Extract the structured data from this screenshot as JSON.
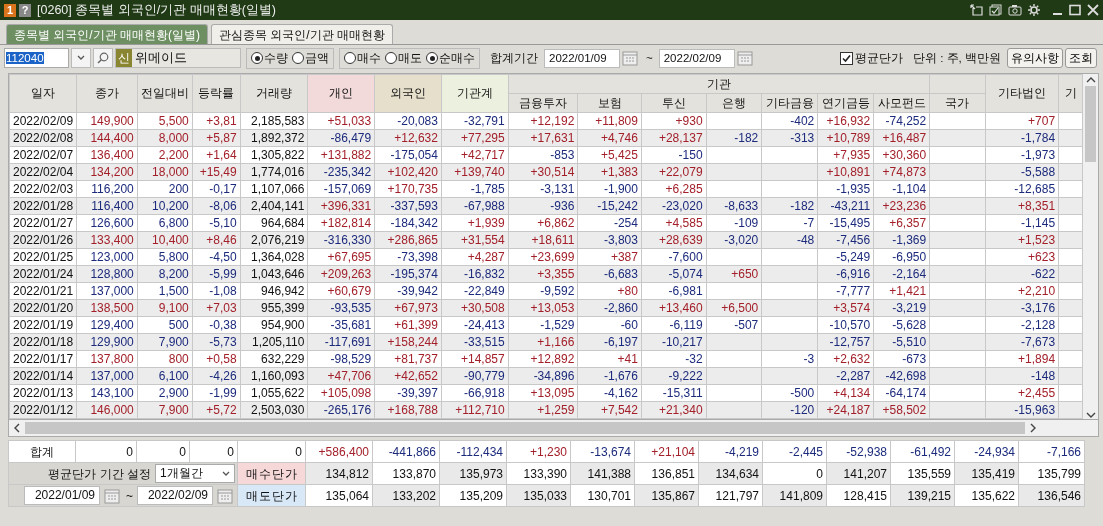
{
  "window": {
    "number_badge": "1",
    "help": "?",
    "title": "[0260] 종목별 외국인/기관 매매현황(일별)"
  },
  "tabs": [
    {
      "label": "종목별 외국인/기관 매매현황(일별)",
      "selected": true
    },
    {
      "label": "관심종목 외국인/기관 매매현황",
      "selected": false
    }
  ],
  "toolbar": {
    "code": "112040",
    "badge": "신",
    "name": "위메이드",
    "measure_options": [
      {
        "label": "수량",
        "selected": true
      },
      {
        "label": "금액",
        "selected": false
      }
    ],
    "side_options": [
      {
        "label": "매수",
        "selected": false
      },
      {
        "label": "매도",
        "selected": false
      },
      {
        "label": "순매수",
        "selected": true
      }
    ],
    "period_label": "합계기간",
    "from": "2022/01/09",
    "tilde": "~",
    "to": "2022/02/09",
    "avg_price": {
      "label": "평균단가",
      "checked": true
    },
    "unit": "단위 : 주, 백만원",
    "buttons": [
      "유의사항",
      "조회"
    ]
  },
  "table": {
    "group_header": "기관",
    "columns": [
      {
        "label": "일자",
        "grouped": false
      },
      {
        "label": "종가",
        "grouped": false
      },
      {
        "label": "전일대비",
        "grouped": false
      },
      {
        "label": "등락률",
        "grouped": false
      },
      {
        "label": "거래량",
        "grouped": false
      },
      {
        "label": "개인",
        "grouped": false
      },
      {
        "label": "외국인",
        "grouped": false
      },
      {
        "label": "기관계",
        "grouped": false
      },
      {
        "label": "금융투자",
        "grouped": true
      },
      {
        "label": "보험",
        "grouped": true
      },
      {
        "label": "투신",
        "grouped": true
      },
      {
        "label": "은행",
        "grouped": true
      },
      {
        "label": "기타금융",
        "grouped": true
      },
      {
        "label": "연기금등",
        "grouped": true
      },
      {
        "label": "사모펀드",
        "grouped": true
      },
      {
        "label": "국가",
        "grouped": false
      },
      {
        "label": "기타법인",
        "grouped": false
      },
      {
        "label": "기",
        "grouped": false
      }
    ],
    "rows": [
      {
        "up": true,
        "cells": [
          "2022/02/09",
          "149,900",
          "5,500",
          "+3,81",
          "2,185,583",
          "+51,033",
          "-20,083",
          "-32,791",
          "+12,192",
          "+11,809",
          "+930",
          null,
          "-402",
          "+16,932",
          "-74,252",
          null,
          "+707"
        ]
      },
      {
        "up": true,
        "cells": [
          "2022/02/08",
          "144,400",
          "8,000",
          "+5,87",
          "1,892,372",
          "-86,479",
          "+12,632",
          "+77,295",
          "+17,631",
          "+4,746",
          "+28,137",
          "-182",
          "-313",
          "+10,789",
          "+16,487",
          null,
          "-1,784"
        ]
      },
      {
        "up": true,
        "cells": [
          "2022/02/07",
          "136,400",
          "2,200",
          "+1,64",
          "1,305,822",
          "+131,882",
          "-175,054",
          "+42,717",
          "-853",
          "+5,425",
          "-150",
          null,
          null,
          "+7,935",
          "+30,360",
          null,
          "-1,973"
        ]
      },
      {
        "up": true,
        "cells": [
          "2022/02/04",
          "134,200",
          "18,000",
          "+15,49",
          "1,774,016",
          "-235,342",
          "+102,420",
          "+139,740",
          "+30,514",
          "+1,383",
          "+22,079",
          null,
          null,
          "+10,891",
          "+74,873",
          null,
          "-5,588"
        ]
      },
      {
        "up": false,
        "cells": [
          "2022/02/03",
          "116,200",
          "200",
          "-0,17",
          "1,107,066",
          "-157,069",
          "+170,735",
          "-1,785",
          "-3,131",
          "-1,900",
          "+6,285",
          null,
          null,
          "-1,935",
          "-1,104",
          null,
          "-12,685"
        ]
      },
      {
        "up": false,
        "cells": [
          "2022/01/28",
          "116,400",
          "10,200",
          "-8,06",
          "2,404,141",
          "+396,331",
          "-337,593",
          "-67,988",
          "-936",
          "-15,242",
          "-23,020",
          "-8,633",
          "-182",
          "-43,211",
          "+23,236",
          null,
          "+8,351"
        ]
      },
      {
        "up": false,
        "cells": [
          "2022/01/27",
          "126,600",
          "6,800",
          "-5,10",
          "964,684",
          "+182,814",
          "-184,342",
          "+1,939",
          "+6,862",
          "-254",
          "+4,585",
          "-109",
          "-7",
          "-15,495",
          "+6,357",
          null,
          "-1,145"
        ]
      },
      {
        "up": true,
        "cells": [
          "2022/01/26",
          "133,400",
          "10,400",
          "+8,46",
          "2,076,219",
          "-316,330",
          "+286,865",
          "+31,554",
          "+18,611",
          "-3,803",
          "+28,639",
          "-3,020",
          "-48",
          "-7,456",
          "-1,369",
          null,
          "+1,523"
        ]
      },
      {
        "up": false,
        "cells": [
          "2022/01/25",
          "123,000",
          "5,800",
          "-4,50",
          "1,364,028",
          "+67,695",
          "-73,398",
          "+4,287",
          "+23,699",
          "+387",
          "-7,600",
          null,
          null,
          "-5,249",
          "-6,950",
          null,
          "+623"
        ]
      },
      {
        "up": false,
        "cells": [
          "2022/01/24",
          "128,800",
          "8,200",
          "-5,99",
          "1,043,646",
          "+209,263",
          "-195,374",
          "-16,832",
          "+3,355",
          "-6,683",
          "-5,074",
          "+650",
          null,
          "-6,916",
          "-2,164",
          null,
          "-622"
        ]
      },
      {
        "up": false,
        "cells": [
          "2022/01/21",
          "137,000",
          "1,500",
          "-1,08",
          "946,942",
          "+60,679",
          "-39,942",
          "-22,849",
          "-9,592",
          "+80",
          "-6,981",
          null,
          null,
          "-7,777",
          "+1,421",
          null,
          "+2,210"
        ]
      },
      {
        "up": true,
        "cells": [
          "2022/01/20",
          "138,500",
          "9,100",
          "+7,03",
          "955,399",
          "-93,535",
          "+67,973",
          "+30,508",
          "+13,053",
          "-2,860",
          "+13,460",
          "+6,500",
          null,
          "+3,574",
          "-3,219",
          null,
          "-3,176"
        ]
      },
      {
        "up": false,
        "cells": [
          "2022/01/19",
          "129,400",
          "500",
          "-0,38",
          "954,900",
          "-35,681",
          "+61,399",
          "-24,413",
          "-1,529",
          "-60",
          "-6,119",
          "-507",
          null,
          "-10,570",
          "-5,628",
          null,
          "-2,128"
        ]
      },
      {
        "up": false,
        "cells": [
          "2022/01/18",
          "129,900",
          "7,900",
          "-5,73",
          "1,205,110",
          "-117,691",
          "+158,244",
          "-33,515",
          "+1,166",
          "-6,197",
          "-10,217",
          null,
          null,
          "-12,757",
          "-5,510",
          null,
          "-7,673"
        ]
      },
      {
        "up": true,
        "cells": [
          "2022/01/17",
          "137,800",
          "800",
          "+0,58",
          "632,229",
          "-98,529",
          "+81,737",
          "+14,857",
          "+12,892",
          "+41",
          "-32",
          null,
          "-3",
          "+2,632",
          "-673",
          null,
          "+1,894"
        ]
      },
      {
        "up": false,
        "cells": [
          "2022/01/14",
          "137,000",
          "6,100",
          "-4,26",
          "1,160,093",
          "+47,706",
          "+42,652",
          "-90,779",
          "-34,896",
          "-1,676",
          "-9,222",
          null,
          null,
          "-2,287",
          "-42,698",
          null,
          "-148"
        ]
      },
      {
        "up": false,
        "cells": [
          "2022/01/13",
          "143,100",
          "2,900",
          "-1,99",
          "1,055,622",
          "+105,098",
          "-39,397",
          "-66,918",
          "+13,095",
          "-4,162",
          "-15,311",
          null,
          "-500",
          "+4,134",
          "-64,174",
          null,
          "+2,455"
        ]
      },
      {
        "up": true,
        "cells": [
          "2022/01/12",
          "146,000",
          "7,900",
          "+5,72",
          "2,503,030",
          "-265,176",
          "+168,788",
          "+112,710",
          "+1,259",
          "+7,542",
          "+21,340",
          null,
          "-120",
          "+24,187",
          "+58,502",
          null,
          "-15,963"
        ]
      }
    ]
  },
  "summary": {
    "label": "합계",
    "values": [
      "0",
      "0",
      "0",
      "0",
      "+586,400",
      "-441,866",
      "-112,434",
      "+1,230",
      "-13,674",
      "+21,104",
      "-4,219",
      "-2,445",
      "-52,938",
      "-61,492",
      "-24,934",
      "-7,166"
    ],
    "setting_label": "평균단가 기간 설정",
    "period": "1개월간",
    "from": "2022/01/09",
    "tilde": "~",
    "to": "2022/02/09",
    "buy": {
      "label": "매수단가",
      "values": [
        "134,812",
        "133,870",
        "135,973",
        "133,390",
        "141,388",
        "136,851",
        "134,634",
        "0",
        "141,207",
        "135,559",
        "135,419",
        "135,799"
      ]
    },
    "sell": {
      "label": "매도단가",
      "values": [
        "135,064",
        "133,202",
        "135,209",
        "135,033",
        "130,701",
        "135,867",
        "121,797",
        "141,809",
        "128,415",
        "139,215",
        "135,622",
        "136,546"
      ]
    }
  }
}
